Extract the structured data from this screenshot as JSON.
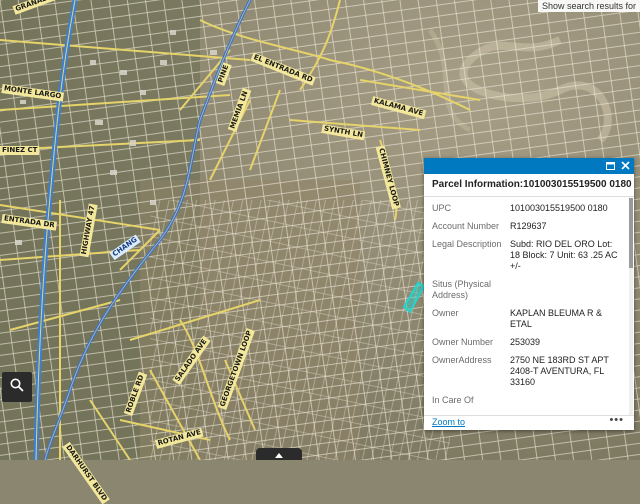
{
  "map": {
    "search_hint": "Show search results for",
    "street_labels": [
      "GRANADA CT",
      "MONTE LARGO",
      "FINEZ CT",
      "ENTRADA DR",
      "HIGHWAY 47",
      "EL ENTRADA RD",
      "KALAMA AVE",
      "SYNTH LN",
      "CHIMNEY LOOP",
      "SALADO AVE",
      "GEORGETOWN LOOP",
      "DARHURST BLVD",
      "ROTAN AVE",
      "ROBLE RD",
      "PINE",
      "MEMIA LN",
      "CHANG"
    ],
    "colors": {
      "highway": "#3a7fd5",
      "roads": "#e6d36a",
      "parcels": "#f2efe2",
      "selected_parcel": "#20d4cf",
      "river": "#2f6fe0"
    }
  },
  "controls": {
    "locate_icon": "search-location-icon",
    "expand_icon": "chevron-up-icon"
  },
  "popup": {
    "title": "Parcel Information:101003015519500 0180",
    "fields": [
      {
        "key": "UPC",
        "value": "101003015519500 0180"
      },
      {
        "key": "Account Number",
        "value": "R129637"
      },
      {
        "key": "Legal Description",
        "value": "Subd: RIO DEL ORO Lot: 18 Block: 7 Unit: 63 .25 AC +/-"
      },
      {
        "key": "Situs (Physical Address)",
        "value": ""
      },
      {
        "key": "Owner",
        "value": "KAPLAN BLEUMA R & ETAL"
      },
      {
        "key": "Owner Number",
        "value": "253039"
      },
      {
        "key": "OwnerAddress",
        "value": "2750 NE 183RD ST APT 2408-T AVENTURA, FL 33160"
      },
      {
        "key": "In Care Of",
        "value": ""
      },
      {
        "key": "Business Name",
        "value": ""
      }
    ],
    "zoom_label": "Zoom to",
    "more_label": "•••"
  }
}
